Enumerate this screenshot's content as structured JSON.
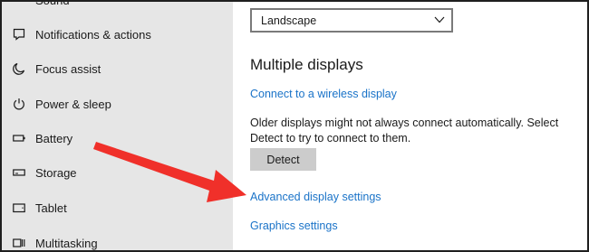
{
  "sidebar": {
    "partial_top_label": "Sound",
    "items": [
      {
        "label": "Notifications & actions",
        "icon": "notifications-icon"
      },
      {
        "label": "Focus assist",
        "icon": "moon-icon"
      },
      {
        "label": "Power & sleep",
        "icon": "power-icon"
      },
      {
        "label": "Battery",
        "icon": "battery-icon"
      },
      {
        "label": "Storage",
        "icon": "storage-icon"
      },
      {
        "label": "Tablet",
        "icon": "tablet-icon"
      },
      {
        "label": "Multitasking",
        "icon": "multitasking-icon"
      }
    ]
  },
  "main": {
    "orientation_value": "Landscape",
    "section_title": "Multiple displays",
    "connect_link": "Connect to a wireless display",
    "description": "Older displays might not always connect automatically. Select Detect to try to connect to them.",
    "detect_button": "Detect",
    "advanced_link": "Advanced display settings",
    "graphics_link": "Graphics settings"
  },
  "colors": {
    "link": "#1a73c8",
    "arrow": "#f0302a",
    "sidebar_bg": "#e6e6e6"
  }
}
